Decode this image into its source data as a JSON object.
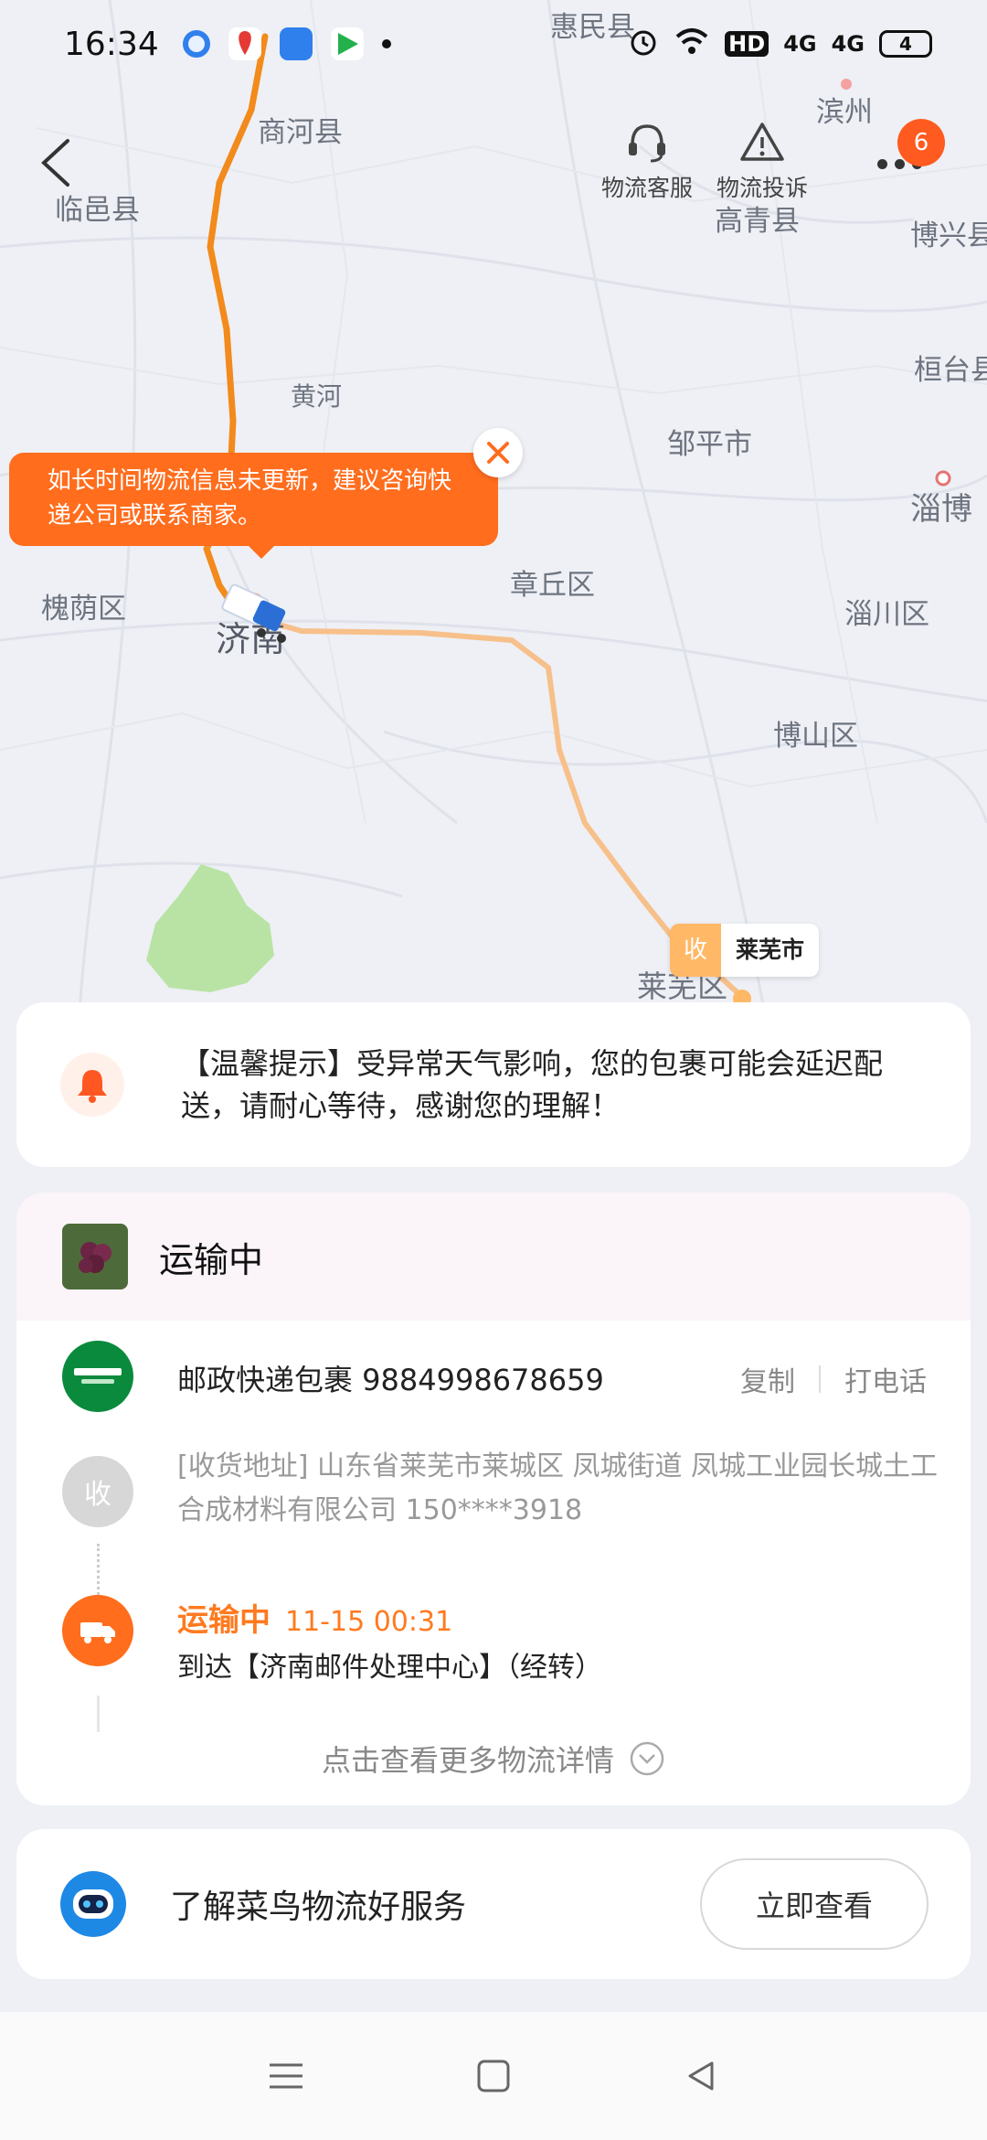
{
  "status_bar": {
    "time": "16:34",
    "network_hd": "HD",
    "network_a": "4G",
    "network_b": "4G",
    "battery": "4"
  },
  "header": {
    "service_label": "物流客服",
    "complaint_label": "物流投诉",
    "badge_count": "6"
  },
  "map": {
    "labels": [
      "惠民县",
      "商河县",
      "临邑县",
      "滨州",
      "高青县",
      "博兴县",
      "黄河",
      "邹平市",
      "桓台县",
      "淄博",
      "槐荫区",
      "济南",
      "章丘区",
      "淄川区",
      "博山区",
      "莱芜区"
    ],
    "tooltip": "如长时间物流信息未更新，建议咨询快递公司或联系商家。",
    "dest_tag": "收",
    "dest_name": "莱芜市",
    "route_color": "#f28a1c"
  },
  "notice": {
    "text": "【温馨提示】受异常天气影响，您的包裹可能会延迟配送，请耐心等待，感谢您的理解！"
  },
  "shipment": {
    "status_title": "运输中",
    "carrier": "邮政快递包裹 9884998678659",
    "copy_label": "复制",
    "call_label": "打电话",
    "address_tag": "收",
    "address": "[收货地址] 山东省莱芜市莱城区 凤城街道 凤城工业园长城土工合成材料有限公司 150****3918",
    "transit_status": "运输中",
    "transit_time": "11-15 00:31",
    "transit_desc": "到达【济南邮件处理中心】（经转）",
    "more_link": "点击查看更多物流详情",
    "accent": "#ff7a1f"
  },
  "service": {
    "text": "了解菜鸟物流好服务",
    "button": "立即查看"
  }
}
